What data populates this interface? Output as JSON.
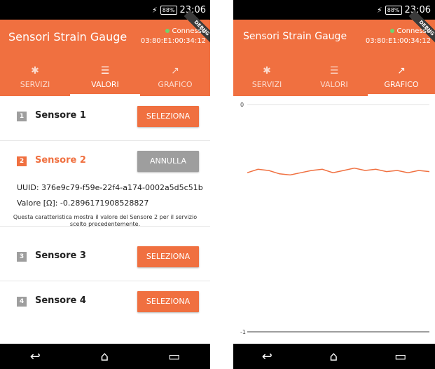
{
  "status": {
    "battery": "88%",
    "time": "23:06"
  },
  "app": {
    "title": "Sensori Strain Gauge",
    "connection_status": "Connesso",
    "mac_address": "03:80:E1:00:34:12",
    "ribbon": "DEBUG"
  },
  "tabs": [
    {
      "label": "SERVIZI",
      "icon": "bluetooth-icon"
    },
    {
      "label": "VALORI",
      "icon": "list-icon"
    },
    {
      "label": "GRAFICO",
      "icon": "trend-icon"
    }
  ],
  "sensors": [
    {
      "number": "1",
      "label": "Sensore 1",
      "button": "SELEZIONA"
    },
    {
      "number": "2",
      "label": "Sensore 2",
      "button": "ANNULLA"
    },
    {
      "number": "3",
      "label": "Sensore 3",
      "button": "SELEZIONA"
    },
    {
      "number": "4",
      "label": "Sensore 4",
      "button": "SELEZIONA"
    }
  ],
  "selected_sensor": {
    "uuid": "UUID: 376e9c79-f59e-22f4-a174-0002a5d5c51b",
    "value": "Valore [Ω]: -0.2896171908528827",
    "description": "Questa caratteristica mostra il valore del Sensore 2 per il servizio scelto precedentemente."
  },
  "colors": {
    "accent": "#f07040",
    "inactive_badge": "#9e9e9e"
  },
  "chart_data": {
    "type": "line",
    "ylim": [
      -1,
      0
    ],
    "y_ticks": [
      "0",
      "-1"
    ],
    "series": [
      {
        "values": [
          -0.3,
          -0.285,
          -0.29,
          -0.305,
          -0.31,
          -0.3,
          -0.29,
          -0.285,
          -0.3,
          -0.29,
          -0.28,
          -0.29,
          -0.285,
          -0.295,
          -0.29,
          -0.3,
          -0.29,
          -0.295
        ]
      }
    ],
    "grid": false
  }
}
